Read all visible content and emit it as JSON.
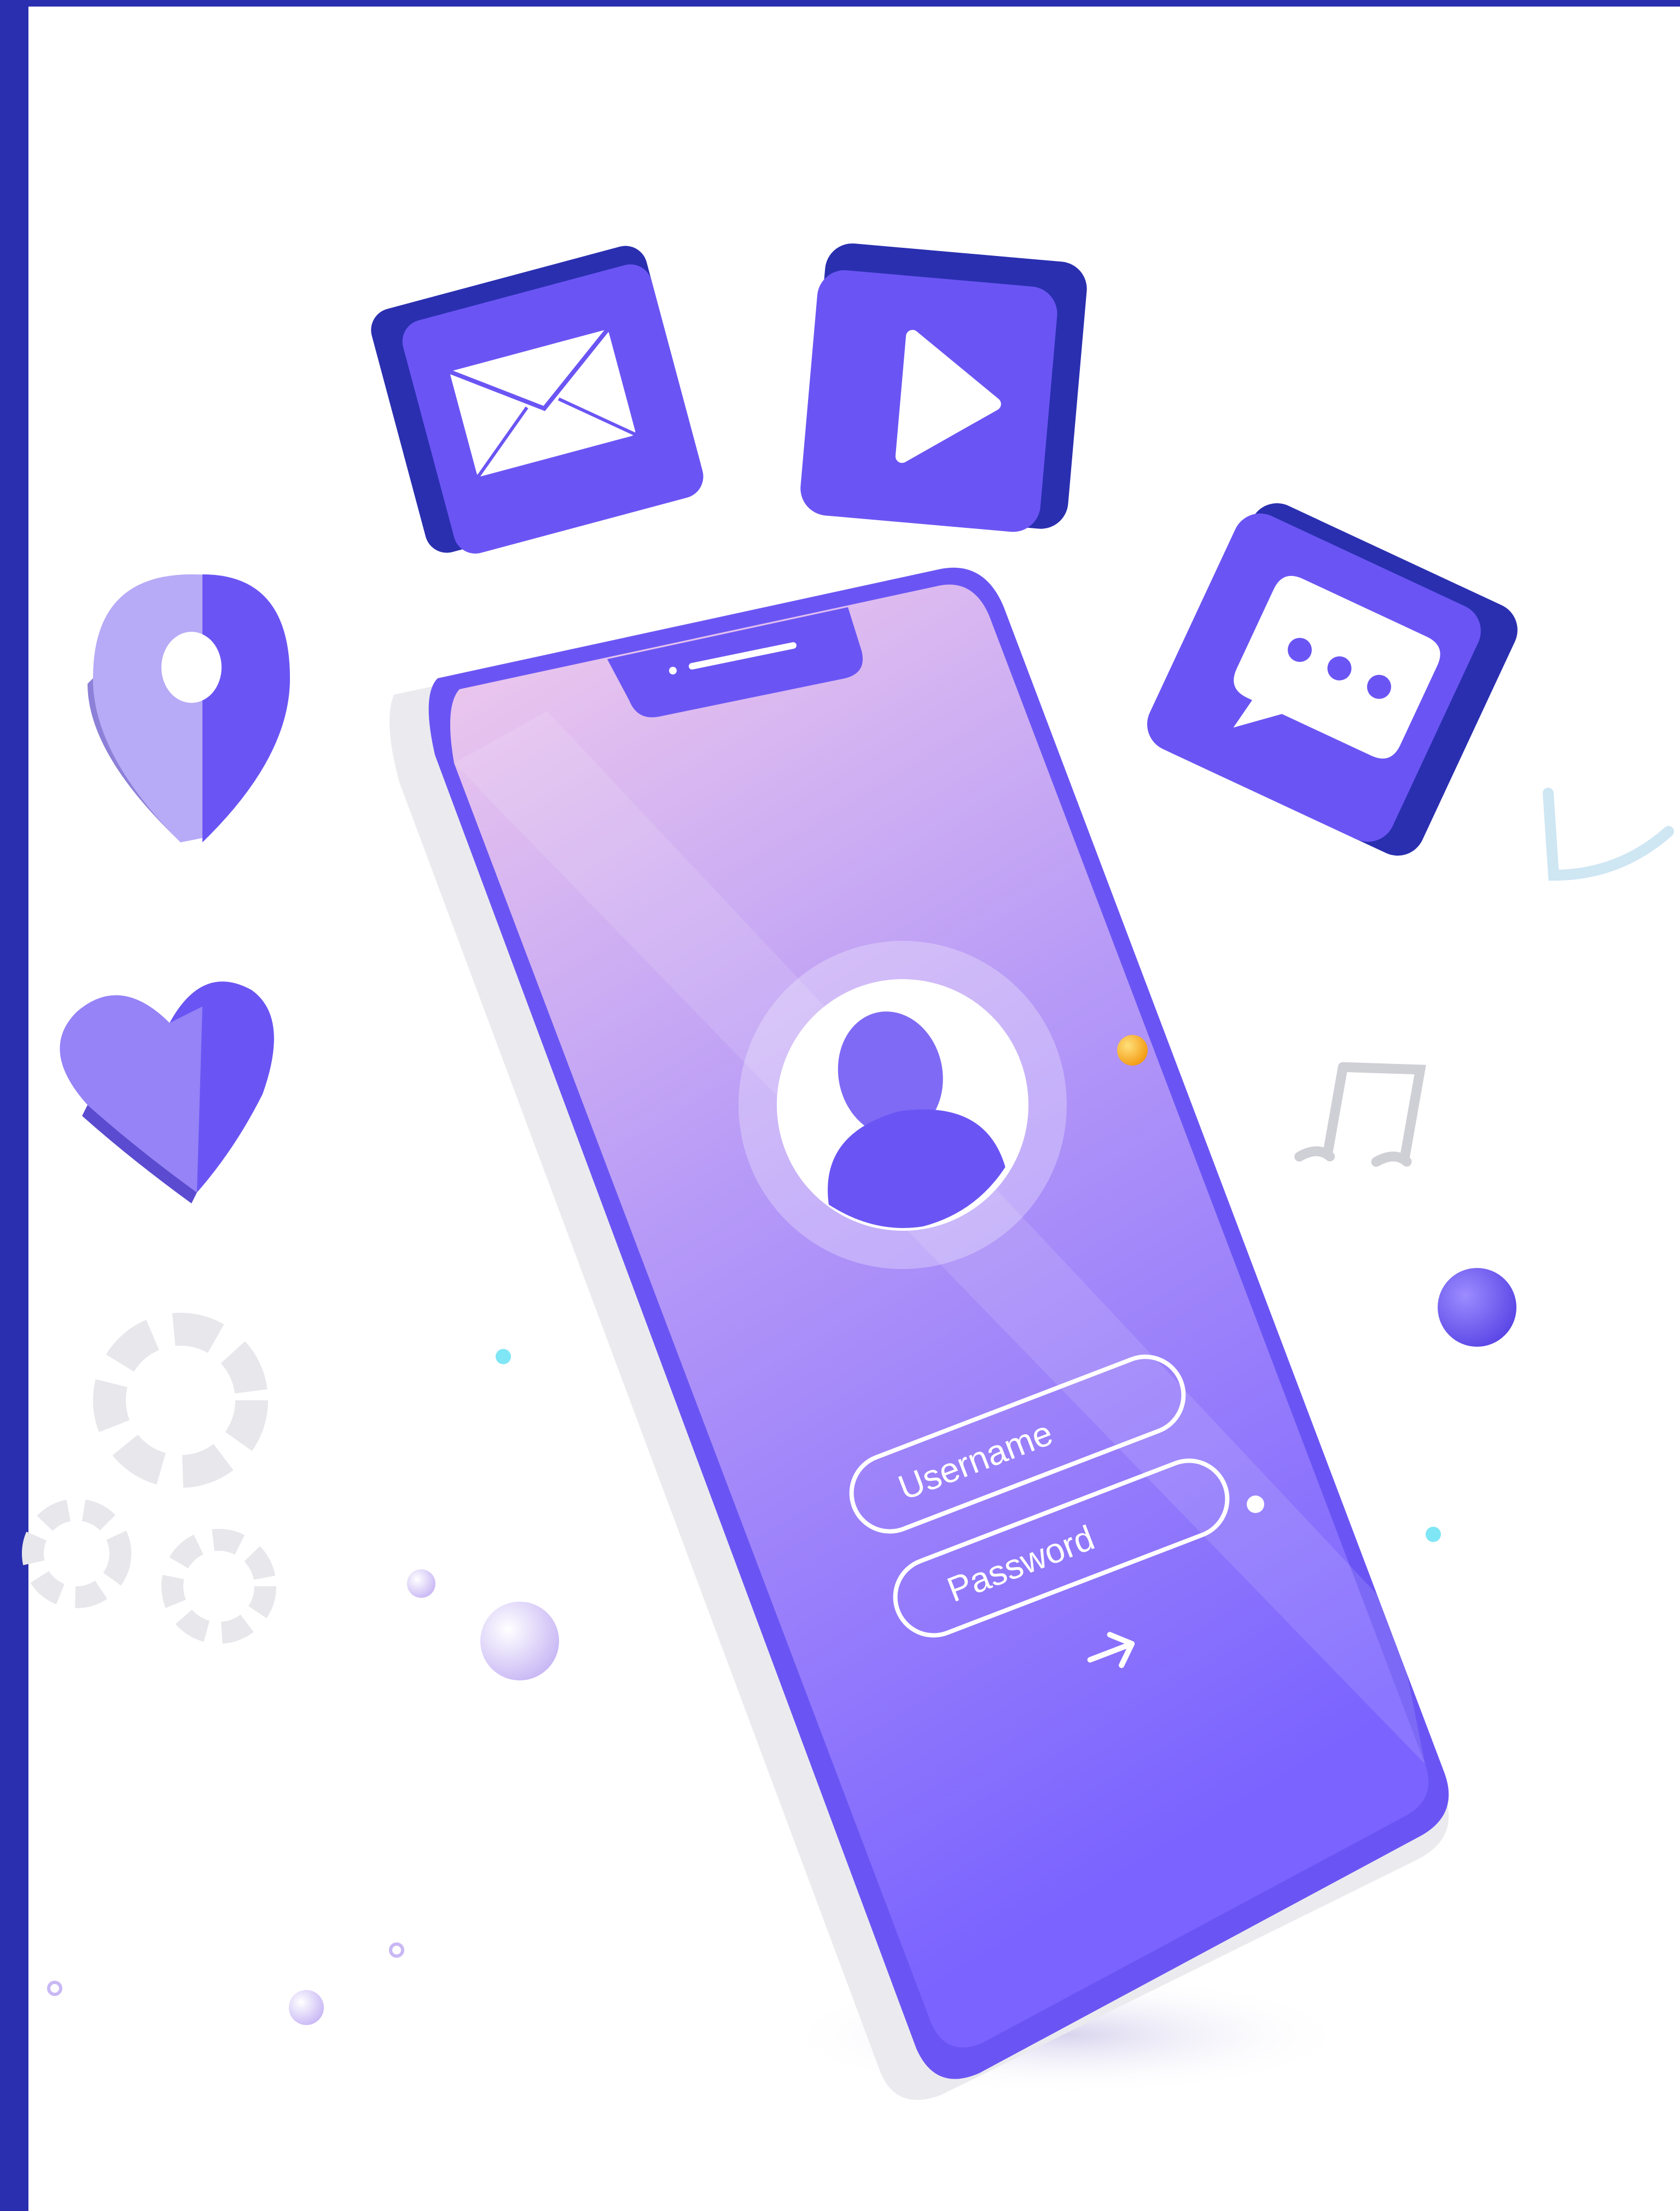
{
  "login": {
    "username_placeholder": "Username",
    "password_placeholder": "Password",
    "submit_icon": "arrow-right-icon"
  },
  "icons": [
    "mail-icon",
    "play-icon",
    "chat-bubble-icon",
    "location-pin-icon",
    "heart-icon",
    "gear-icon",
    "music-note-icon",
    "user-avatar-icon"
  ],
  "colors": {
    "frame": "#2a2fb0",
    "accent": "#6b55f5",
    "accent_dark": "#3a30c9",
    "screen_top": "#f0c9ec",
    "screen_bottom": "#7c66ff",
    "orb": "#f7a51c",
    "dot": "#7fe6f5"
  }
}
